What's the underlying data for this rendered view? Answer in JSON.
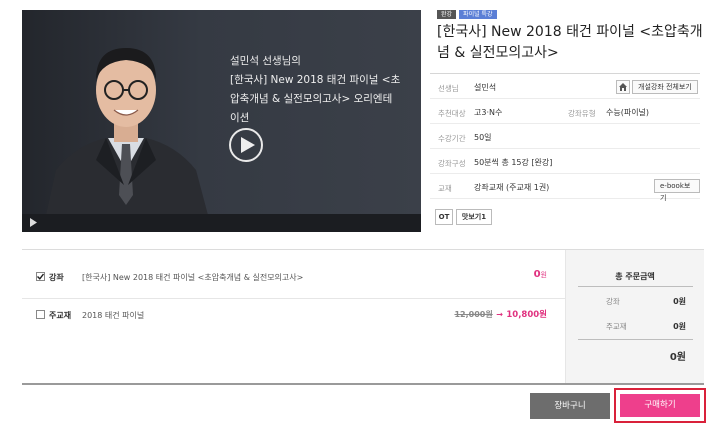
{
  "video": {
    "overlay_lines": [
      "설민석 선생님의",
      "[한국사] New 2018 태건 파이널 <초",
      "압축개념 & 실전모의고사> 오리엔테",
      "이션"
    ]
  },
  "badges": [
    "완강",
    "파이널 특강"
  ],
  "course": {
    "title": "[한국사] New 2018 태건 파이널 <초압축개념 & 실전모의고사>"
  },
  "info": {
    "teacher_label": "선생님",
    "teacher_value": "설민석",
    "all_courses_label": "개설강좌 전체보기",
    "target_label": "추천대상",
    "target_value": "고3·N수",
    "type_label": "강좌유형",
    "type_value": "수능(파이널)",
    "period_label": "수강기간",
    "period_value": "50일",
    "composition_label": "강좌구성",
    "composition_value": "50분씩 총 15강 [완강]",
    "material_label": "교재",
    "material_value": "강좌교재 (주교재 1권)",
    "ebook_label": "e-book보기",
    "ot_label": "OT",
    "preview_label": "맛보기1"
  },
  "order": {
    "row1": {
      "category": "강좌",
      "name": "[한국사] New 2018 태건 파이널 <초압축개념 & 실전모의고사>",
      "price": "0",
      "won": "원"
    },
    "row2": {
      "category": "주교재",
      "name": "2018 태건 파이널",
      "original_price": "12,000원",
      "arrow": "→",
      "sale_price": "10,800원"
    }
  },
  "summary": {
    "title": "총 주문금액",
    "lecture_label": "강좌",
    "lecture_value": "0원",
    "book_label": "주교재",
    "book_value": "0원",
    "total_value": "0원"
  },
  "actions": {
    "cart_label": "장바구니",
    "buy_label": "구매하기"
  },
  "colors": {
    "accent_pink": "#ee3f8c",
    "highlight_red": "#d9213a",
    "price_pink": "#e0317f"
  }
}
